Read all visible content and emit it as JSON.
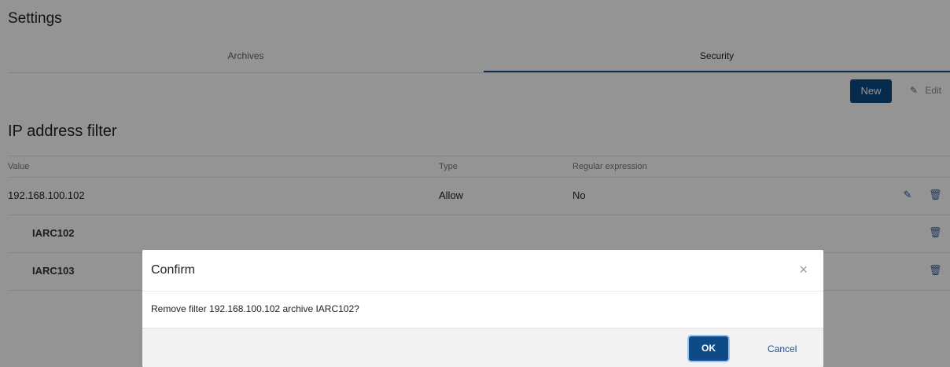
{
  "page": {
    "title": "Settings",
    "tabs": [
      {
        "label": "Archives",
        "active": false
      },
      {
        "label": "Security",
        "active": true
      }
    ],
    "toolbar": {
      "new_label": "New",
      "edit_label": "Edit"
    },
    "section_title": "IP address filter",
    "table": {
      "headers": {
        "value": "Value",
        "type": "Type",
        "regex": "Regular expression"
      },
      "rows": [
        {
          "value": "192.168.100.102",
          "type": "Allow",
          "regex": "No"
        },
        {
          "value": "IARC102"
        },
        {
          "value": "IARC103"
        }
      ]
    }
  },
  "dialog": {
    "title": "Confirm",
    "message": "Remove filter 192.168.100.102 archive IARC102?",
    "ok_label": "OK",
    "cancel_label": "Cancel",
    "close_glyph": "×"
  },
  "icons": {
    "edit": "pencil-icon",
    "delete": "trash-icon",
    "close": "close-icon"
  },
  "colors": {
    "primary": "#0d4a86",
    "overlay": "rgba(0,0,0,0.42)",
    "link": "#1f4e8c"
  }
}
